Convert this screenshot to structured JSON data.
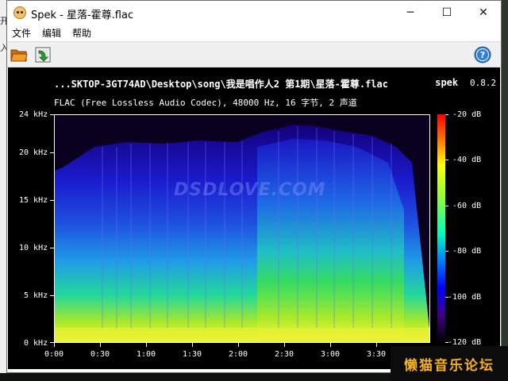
{
  "window": {
    "title": "Spek - 星落-霍尊.flac",
    "controls": {
      "minimize": "─",
      "maximize": "☐",
      "close": "✕"
    }
  },
  "menu": {
    "items": [
      "文件",
      "编辑",
      "帮助"
    ]
  },
  "toolbar": {
    "open_icon": "folder-open-icon",
    "save_icon": "save-arrow-icon",
    "help_icon": "help-icon"
  },
  "spek": {
    "file_path": "...SKTOP-3GT74AD\\Desktop\\song\\我是唱作人2 第1期\\星落-霍尊.flac",
    "app_name": "spek",
    "version": "0.8.2",
    "info": "FLAC (Free Lossless Audio Codec), 48000 Hz, 16 字节, 2 声道",
    "watermark": "DSDLOVE.COM",
    "y_labels": [
      "24 kHz",
      "20 kHz",
      "15 kHz",
      "10 kHz",
      "5 kHz",
      "0 kHz"
    ],
    "x_labels": [
      "0:00",
      "0:30",
      "1:00",
      "1:30",
      "2:00",
      "2:30",
      "3:00",
      "3:30"
    ],
    "db_labels": [
      "-20 dB",
      "-40 dB",
      "-60 dB",
      "-80 dB",
      "-100 dB",
      "-120 dB"
    ],
    "colors": {
      "background": "#000000",
      "text": "#ffffff"
    }
  },
  "background": {
    "left_fragments": [
      "开",
      "入"
    ],
    "corner_watermark": "懒猫音乐论坛"
  }
}
